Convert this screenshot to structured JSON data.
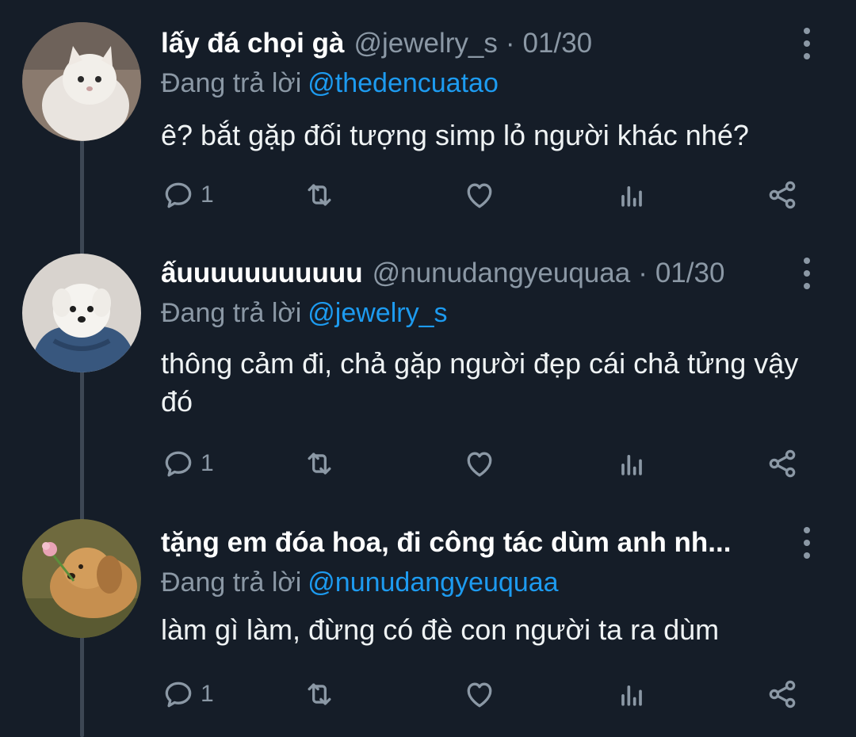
{
  "replies": [
    {
      "name": "lấy đá chọi gà",
      "handle": "@jewelry_s",
      "separator": "·",
      "date": "01/30",
      "reply_label": "Đang trả lời",
      "reply_to": "@thedencuatao",
      "text": "ê? bắt gặp đối tượng simp lỏ người khác nhé?",
      "reply_count": "1",
      "avatar": "white-kitten"
    },
    {
      "name": "ấuuuuuuuuuuu",
      "handle": "@nunudangyeuquaa",
      "separator": "·",
      "date": "01/30",
      "reply_label": "Đang trả lời",
      "reply_to": "@jewelry_s",
      "text": "thông cảm đi, chả gặp người đẹp cái chả tửng vậy đó",
      "reply_count": "1",
      "avatar": "white-puppy-in-hoodie"
    },
    {
      "name": "tặng em đóa hoa, đi công tác dùm anh nh...",
      "handle": "",
      "separator": "",
      "date": "",
      "reply_label": "Đang trả lời",
      "reply_to": "@nunudangyeuquaa",
      "text": "làm gì làm, đừng có đè con người ta ra dùm",
      "reply_count": "1",
      "avatar": "golden-dog-with-flower"
    }
  ],
  "icons": {
    "reply": "reply-icon",
    "retweet": "retweet-icon",
    "like": "heart-icon",
    "analytics": "analytics-icon",
    "share": "share-icon",
    "more": "more-vertical-icon"
  },
  "colors": {
    "background": "#151d28",
    "secondary_text": "#8b98a5",
    "link": "#1d9bf0",
    "thread_line": "#3d4754"
  }
}
